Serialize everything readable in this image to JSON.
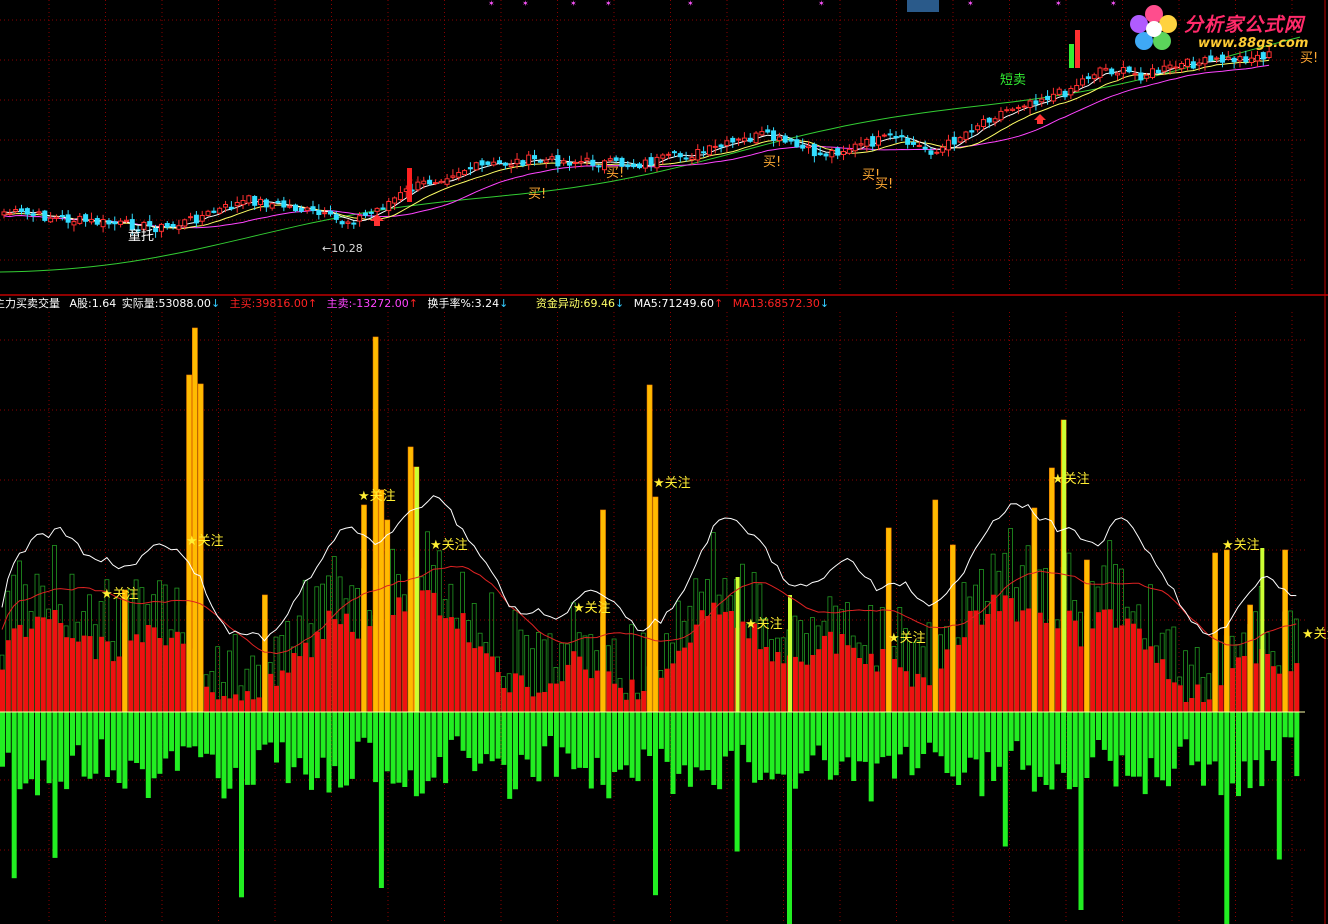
{
  "logo": {
    "cn_text": "分析家公式网",
    "url_text": "www.88gs.com"
  },
  "colors": {
    "background": "#000000",
    "grid": "#8b0000",
    "divider": "#c00000",
    "up_candle": "#ff3030",
    "down_candle": "#33ddff",
    "ma_fast": "#ffffff",
    "ma_mid": "#ffff66",
    "ma_slow": "#ff44ff",
    "ma_long": "#33cc33",
    "buy_vol": "#ee1111",
    "sell_vol": "#22ee22",
    "highlight_bar": "#ffbb00",
    "highlight_bar_alt": "#ccff33",
    "ma5_line": "#ffffff",
    "ma13_line": "#dd2222",
    "mark_text": "#ffee33"
  },
  "price_panel": {
    "labels": {
      "tong_tuo": "童托",
      "low_price": "←10.28",
      "short_sell": "短卖",
      "buy_1": "买!",
      "buy_2": "买!",
      "buy_3": "买!",
      "buy_4": "买!",
      "buy_5": "买!",
      "buy_right": "买!"
    }
  },
  "indicator_panel": {
    "legend": {
      "title": "主力买卖交量",
      "a_share": "A股:1.64",
      "actual_volume": "实际量:53088.00",
      "main_buy": "主买:39816.00",
      "main_sell": "主卖:-13272.00",
      "turnover": "换手率%:3.24",
      "fund_anomaly": "资金异动:69.46",
      "ma5": "MA5:71249.60",
      "ma13": "MA13:68572.30"
    },
    "attention_label": "★关注"
  },
  "chart_data": [
    {
      "type": "candlestick",
      "title": "",
      "price_annotations": [
        {
          "text": "←10.28",
          "value": 10.28
        }
      ],
      "series": [
        {
          "kind": "ohlc"
        },
        {
          "kind": "moving_average"
        },
        {
          "kind": "moving_average"
        },
        {
          "kind": "moving_average"
        },
        {
          "kind": "moving_average"
        }
      ]
    },
    {
      "type": "bar",
      "title": "主力买卖交量",
      "legend_values": {
        "A股": 1.64,
        "实际量": 53088.0,
        "主买": 39816.0,
        "主卖": -13272.0,
        "换手率%": 3.24,
        "资金异动": 69.46,
        "MA5": 71249.6,
        "MA13": 68572.3
      },
      "series": [
        {
          "name": "主买"
        },
        {
          "name": "主卖"
        },
        {
          "name": "MA5"
        },
        {
          "name": "MA13"
        }
      ]
    }
  ]
}
